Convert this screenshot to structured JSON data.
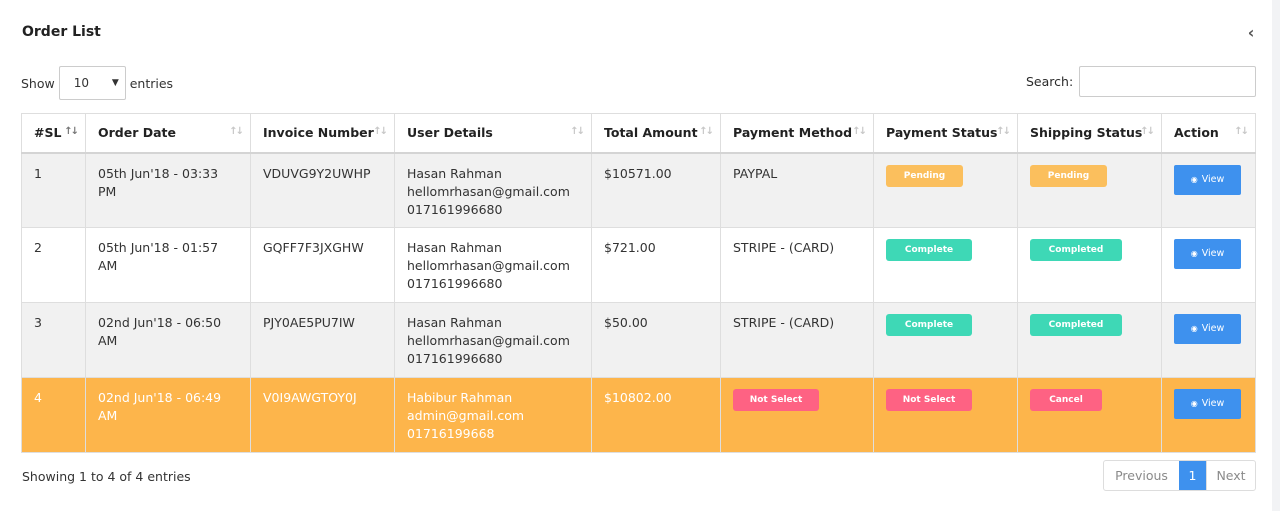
{
  "header": {
    "title": "Order List"
  },
  "length": {
    "show_label": "Show",
    "value": "10",
    "entries_label": "entries"
  },
  "search": {
    "label": "Search:",
    "value": ""
  },
  "columns": [
    "#SL",
    "Order Date",
    "Invoice Number",
    "User Details",
    "Total Amount",
    "Payment Method",
    "Payment Status",
    "Shipping Status",
    "Action"
  ],
  "rows": [
    {
      "sl": "1",
      "date": "05th Jun'18 - 03:33 PM",
      "invoice": "VDUVG9Y2UWHP",
      "name": "Hasan Rahman",
      "email": "hellomrhasan@gmail.com",
      "phone": "017161996680",
      "amount": "$10571.00",
      "method": "PAYPAL",
      "payment_status": "Pending",
      "shipping_status": "Pending",
      "action": "View"
    },
    {
      "sl": "2",
      "date": "05th Jun'18 - 01:57 AM",
      "invoice": "GQFF7F3JXGHW",
      "name": "Hasan Rahman",
      "email": "hellomrhasan@gmail.com",
      "phone": "017161996680",
      "amount": "$721.00",
      "method": "STRIPE - (CARD)",
      "payment_status": "Complete",
      "shipping_status": "Completed",
      "action": "View"
    },
    {
      "sl": "3",
      "date": "02nd Jun'18 - 06:50 AM",
      "invoice": "PJY0AE5PU7IW",
      "name": "Hasan Rahman",
      "email": "hellomrhasan@gmail.com",
      "phone": "017161996680",
      "amount": "$50.00",
      "method": "STRIPE - (CARD)",
      "payment_status": "Complete",
      "shipping_status": "Completed",
      "action": "View"
    },
    {
      "sl": "4",
      "date": "02nd Jun'18 - 06:49 AM",
      "invoice": "V0I9AWGTOY0J",
      "name": "Habibur Rahman",
      "email": "admin@gmail.com",
      "phone": "01716199668",
      "amount": "$10802.00",
      "method": "Not Select",
      "payment_status": "Not Select",
      "shipping_status": "Cancel",
      "action": "View"
    }
  ],
  "footer": {
    "info": "Showing 1 to 4 of 4 entries"
  },
  "pagination": {
    "previous": "Previous",
    "current": "1",
    "next": "Next"
  },
  "colors": {
    "accent": "#3e91ee",
    "pending": "#fbbf5d",
    "complete": "#3ed8b6",
    "danger": "#fe6283",
    "highlight_row": "#fdb54b"
  },
  "icons": {
    "collapse": "chevron-left-icon",
    "view": "eye-icon",
    "sort": "sort-icon"
  }
}
